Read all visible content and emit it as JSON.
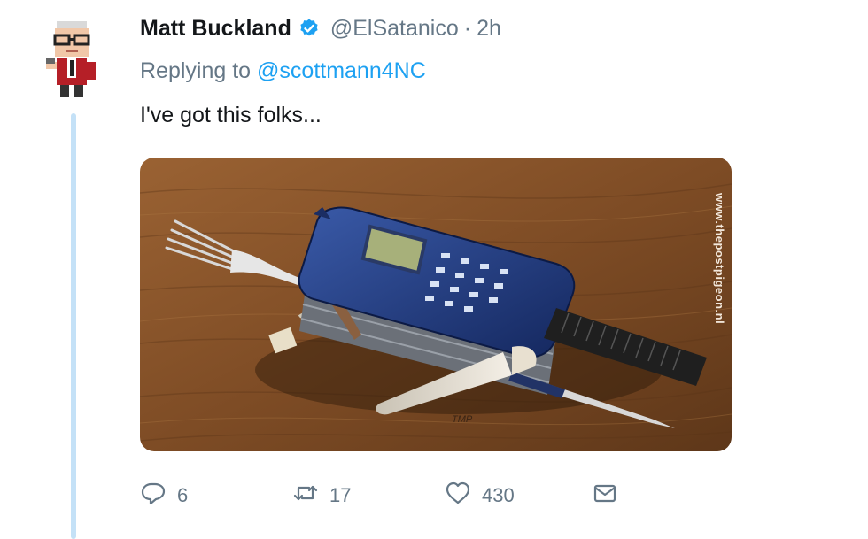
{
  "tweet": {
    "author_name": "Matt Buckland",
    "author_handle": "@ElSatanico",
    "separator": "·",
    "time": "2h",
    "reply_prefix": "Replying to",
    "reply_to": "@scottmann4NC",
    "text": "I've got this folks...",
    "verified": true
  },
  "media": {
    "watermark": "www.thepostpigeon.nl",
    "signature": "TMP"
  },
  "actions": {
    "replies": "6",
    "retweets": "17",
    "likes": "430"
  },
  "colors": {
    "link": "#1da1f2",
    "muted": "#657786",
    "thread_line": "#c4e1f7",
    "verified": "#1da1f2"
  },
  "icons": [
    "reply-icon",
    "retweet-icon",
    "like-icon",
    "direct-message-icon",
    "verified-badge-icon"
  ]
}
